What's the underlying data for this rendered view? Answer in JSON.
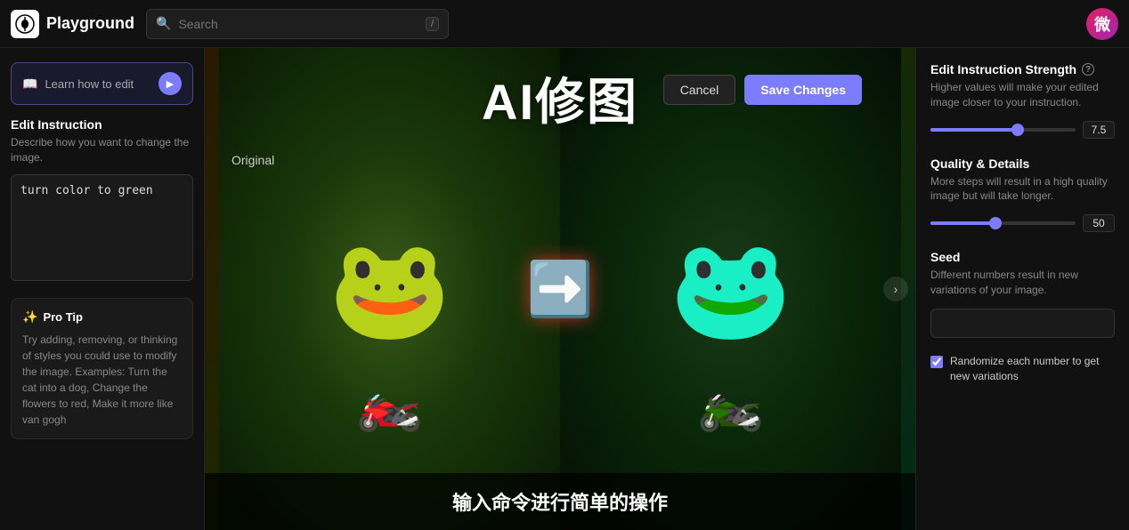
{
  "header": {
    "logo_text": "Playground",
    "search_placeholder": "Search",
    "search_shortcut": "/",
    "user_initial": "微"
  },
  "sidebar": {
    "learn_how_label": "Learn how to edit",
    "edit_instruction_title": "Edit Instruction",
    "edit_instruction_desc": "Describe how you want to change the image.",
    "edit_textarea_value": "turn color to green",
    "pro_tip_title": "Pro Tip",
    "pro_tip_text": "Try adding, removing, or thinking of styles you could use to modify the image. Examples: Turn the cat into a dog, Change the flowers to red, Make it more like van gogh"
  },
  "canvas": {
    "title": "AI修图",
    "cancel_label": "Cancel",
    "save_label": "Save Changes",
    "original_label": "Original",
    "bottom_subtitle": "输入命令进行简单的操作"
  },
  "right_panel": {
    "strength_title": "Edit Instruction Strength",
    "strength_info": "?",
    "strength_desc": "Higher values will make your edited image closer to your instruction.",
    "strength_value": "7.5",
    "strength_percent": 60,
    "quality_title": "Quality & Details",
    "quality_desc": "More steps will result in a high quality image but will take longer.",
    "quality_value": "50",
    "quality_percent": 45,
    "seed_title": "Seed",
    "seed_desc": "Different numbers result in new variations of your image.",
    "seed_placeholder": "",
    "randomize_label": "Randomize each number to get new variations"
  }
}
